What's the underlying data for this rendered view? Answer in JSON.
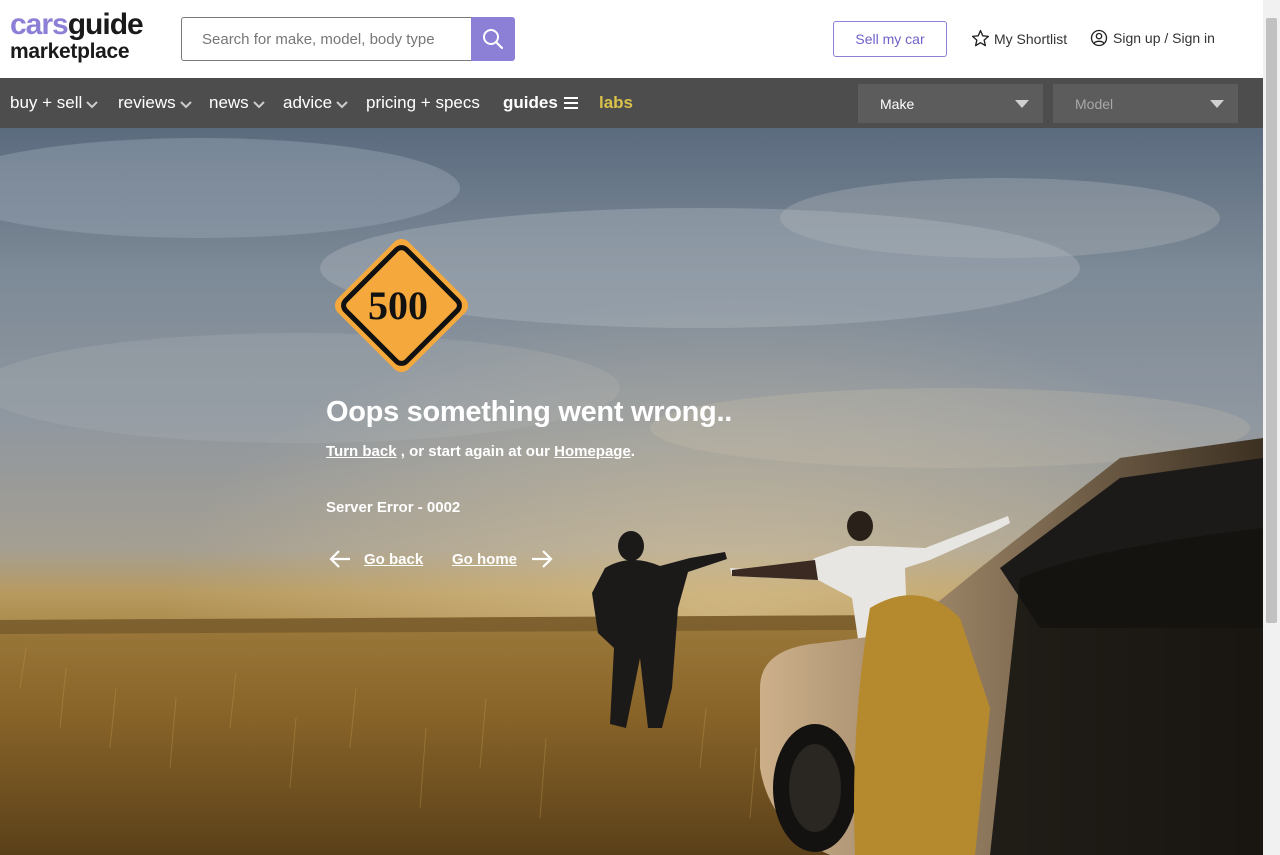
{
  "header": {
    "logo_part1": "cars",
    "logo_part2": "guide",
    "logo_line2": "marketplace",
    "search_placeholder": "Search for make, model, body type",
    "search_icon": "search-icon",
    "sell_label": "Sell my car",
    "shortlist_label": "My Shortlist",
    "shortlist_icon": "star-icon",
    "signin_label": "Sign up / Sign in",
    "signin_icon": "user-circle-icon",
    "brand_color": "#8b7fd6"
  },
  "nav": {
    "items": [
      {
        "label": "buy + sell"
      },
      {
        "label": "reviews"
      },
      {
        "label": "news"
      },
      {
        "label": "advice"
      },
      {
        "label": "pricing + specs"
      },
      {
        "label": "guides"
      },
      {
        "label": "labs"
      }
    ],
    "make_label": "Make",
    "model_label": "Model"
  },
  "error": {
    "sign_code": "500",
    "title": "Oops something went wrong..",
    "turn_back": "Turn back",
    "middle_text": " , or start again at our ",
    "homepage": "Homepage",
    "end_text": ".",
    "code_text": "Server Error - 0002",
    "go_back": "Go back",
    "go_home": "Go home",
    "sign_color": "#f5a93c"
  }
}
